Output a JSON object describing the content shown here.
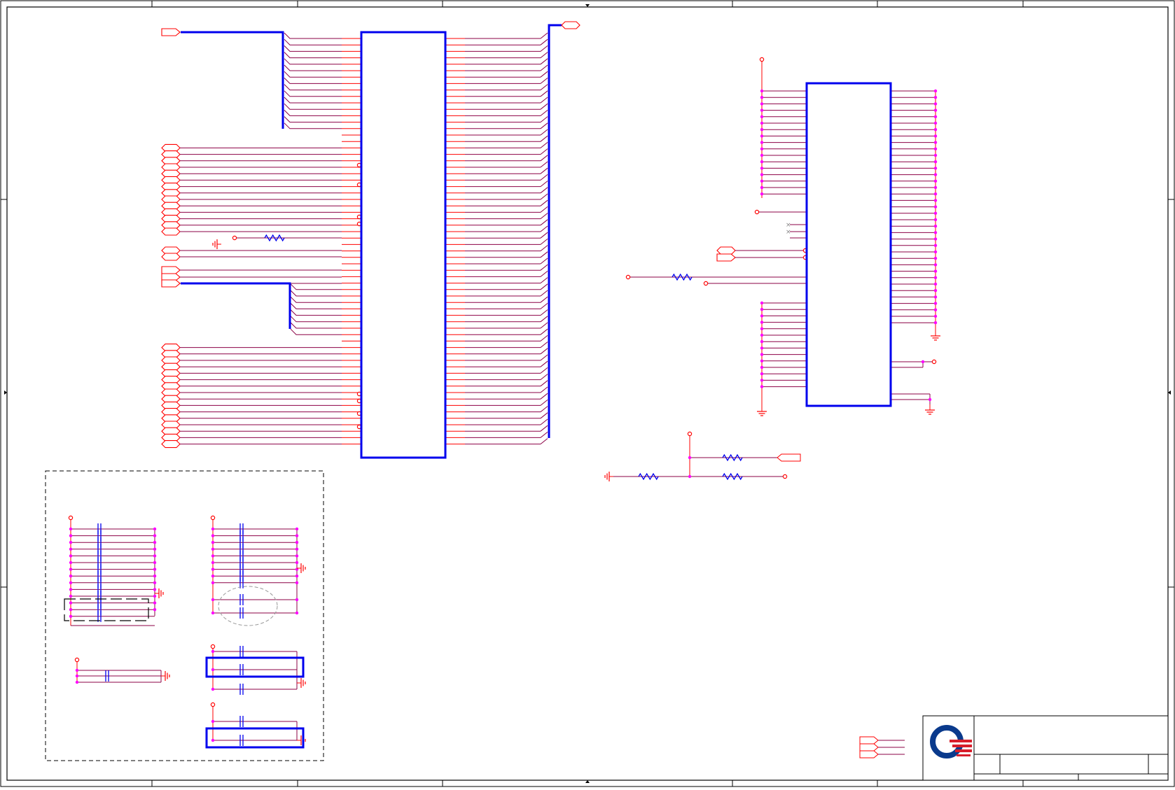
{
  "sheet": {
    "type": "schematic",
    "background": "#ffffff",
    "colors": {
      "frame": "#000000",
      "net": "#8b0045",
      "pin": "#ff0000",
      "bus": "#0000ee",
      "junction": "#ff00ff",
      "power": "#ff0000",
      "dashed_group": "#000000",
      "ellipse": "#999999"
    }
  },
  "logo": {
    "name": "company-logo",
    "colors": {
      "ring": "#0a3a8c",
      "stripes": "#d81e2b"
    }
  },
  "components": {
    "connector_large": "connector-symbol",
    "ic_right": "ic-symbol",
    "decoupling_group": "decoupling-capacitor-group"
  }
}
